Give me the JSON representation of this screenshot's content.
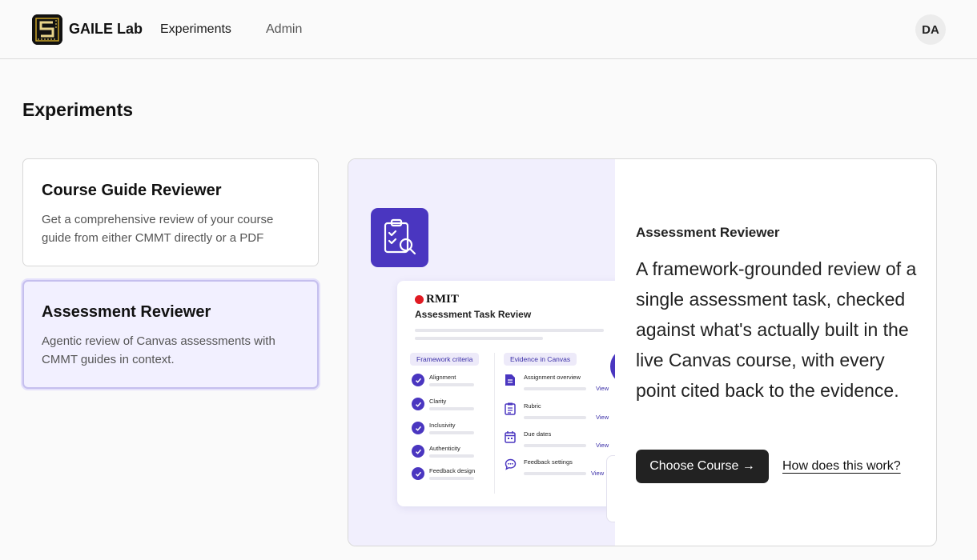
{
  "header": {
    "brand": "GAILE Lab",
    "nav": {
      "experiments": "Experiments",
      "admin": "Admin"
    },
    "avatar_initials": "DA"
  },
  "page": {
    "title": "Experiments"
  },
  "experiments": [
    {
      "title": "Course Guide Reviewer",
      "description": "Get a comprehensive review of your course guide from either CMMT directly or a PDF",
      "selected": false
    },
    {
      "title": "Assessment Reviewer",
      "description": "Agentic review of Canvas assessments with CMMT guides in context.",
      "selected": true
    }
  ],
  "detail": {
    "title": "Assessment Reviewer",
    "description": "A framework-grounded review of a single assessment task, checked against what's actually built in the live Canvas course, with every point cited back to the evidence.",
    "primary_button": "Choose Course →",
    "secondary_link": "How does this work?",
    "preview": {
      "org": "RMIT",
      "title": "Assessment Task Review",
      "left_heading": "Framework criteria",
      "right_heading": "Evidence in Canvas",
      "criteria": [
        "Alignment",
        "Clarity",
        "Inclusivity",
        "Authenticity",
        "Feedback design"
      ],
      "evidence": [
        {
          "label": "Assignment overview",
          "icon": "document-icon",
          "action": "View"
        },
        {
          "label": "Rubric",
          "icon": "checklist-icon",
          "action": "View"
        },
        {
          "label": "Due dates",
          "icon": "calendar-icon",
          "action": "View"
        },
        {
          "label": "Feedback settings",
          "icon": "chat-icon",
          "action": "View"
        }
      ]
    }
  },
  "colors": {
    "accent": "#4a36c0",
    "selected_card_bg": "#f2f0ff",
    "preview_bg": "#f1effd",
    "primary_button_bg": "#222222"
  }
}
